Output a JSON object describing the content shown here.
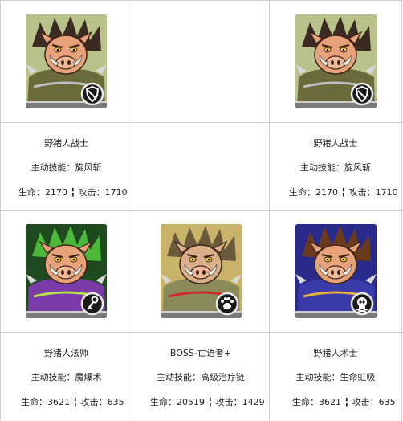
{
  "cards": [
    {
      "id": "boar-warrior-1",
      "name": "野猪人战士",
      "skill": "主动技能：旋风斩",
      "stats": "生命：2170 ╏ 攻击：1710",
      "class_icon": "shield-icon",
      "palette": {
        "bg": "#b9c28a",
        "fur": "#e8a27a",
        "hair": "#3a2a22",
        "armor": "#6a6a3a",
        "accent": "#c0c0c0"
      }
    },
    {
      "id": "empty",
      "name": "",
      "skill": "",
      "stats": ""
    },
    {
      "id": "boar-warrior-2",
      "name": "野猪人战士",
      "skill": "主动技能：旋风斩",
      "stats": "生命：2170 ╏ 攻击：1710",
      "class_icon": "shield-icon",
      "palette": {
        "bg": "#b9c28a",
        "fur": "#e8a27a",
        "hair": "#3a2a22",
        "armor": "#6a6a3a",
        "accent": "#c0c0c0"
      }
    },
    {
      "id": "boar-mage",
      "name": "野猪人法师",
      "skill": "主动技能：魔爆术",
      "stats": "生命：3621 ╏ 攻击：635",
      "class_icon": "key-staff-icon",
      "palette": {
        "bg": "#1f4a1f",
        "fur": "#e8a27a",
        "hair": "#4bb83a",
        "armor": "#7a3aa8",
        "accent": "#b8e04a"
      }
    },
    {
      "id": "boss-deathspeaker",
      "name": "BOSS-亡语者+",
      "skill": "主动技能：高级治疗链",
      "stats": "生命：20519 ╏ 攻击：1429",
      "class_icon": "paw-icon",
      "palette": {
        "bg": "#c9b36a",
        "fur": "#d9b08a",
        "hair": "#6a5a3a",
        "armor": "#8a8a5a",
        "accent": "#d02a2a"
      }
    },
    {
      "id": "boar-warlock",
      "name": "野猪人术士",
      "skill": "主动技能：生命虹吸",
      "stats": "生命：3621 ╏ 攻击：635",
      "class_icon": "skull-icon",
      "palette": {
        "bg": "#2a2a8a",
        "fur": "#e8a27a",
        "hair": "#6a3a1a",
        "armor": "#3a3aa8",
        "accent": "#e0b040"
      }
    }
  ]
}
